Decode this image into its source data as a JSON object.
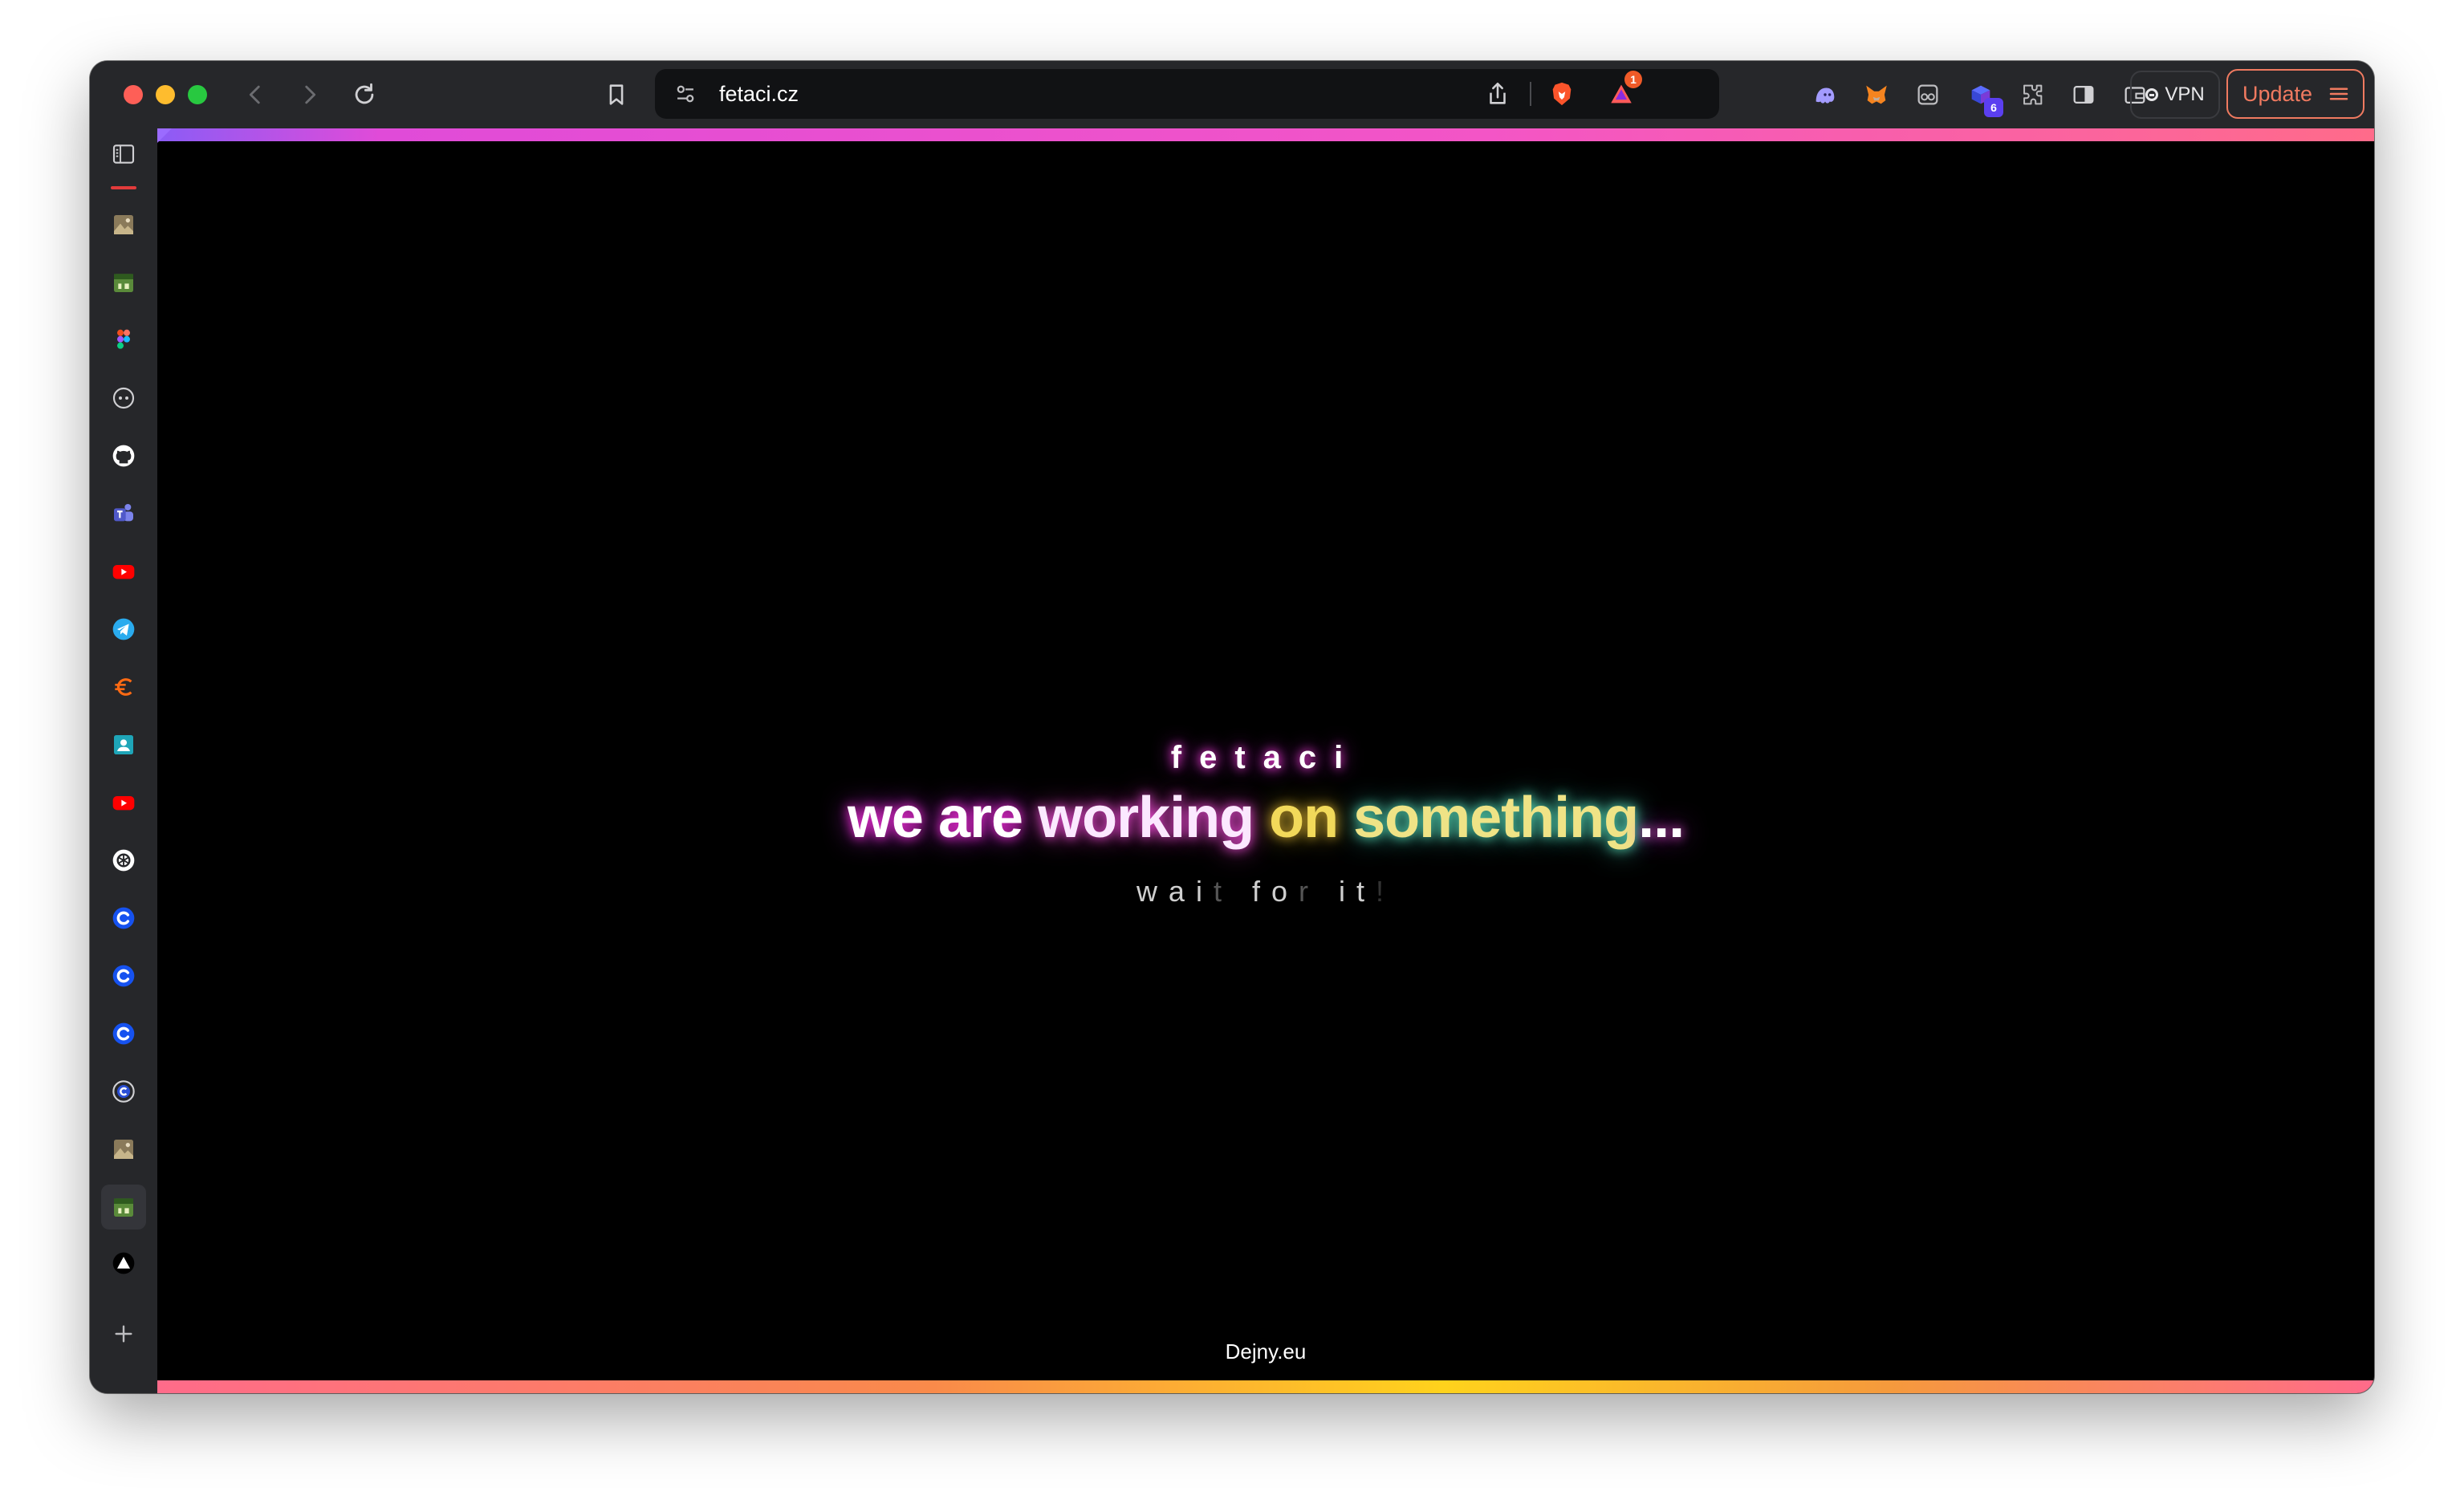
{
  "browser": {
    "url": "fetaci.cz",
    "vpn_label": "VPN",
    "update_label": "Update",
    "alert_badge": "1",
    "extension_badge": "6"
  },
  "sidebar": {
    "items": [
      "sidebar-toggle-icon",
      "image-icon",
      "calendar-icon",
      "figma-icon",
      "chat-icon",
      "github-icon",
      "teams-icon",
      "youtube-icon",
      "telegram-icon",
      "euro-icon",
      "contacts-icon",
      "youtube-icon",
      "openai-icon",
      "c-icon",
      "c-icon",
      "c-icon",
      "c-ring-icon",
      "image-icon",
      "calendar-icon",
      "triangle-icon",
      "plus-icon"
    ]
  },
  "page": {
    "brand": "fetaci",
    "headline_parts": [
      "we are ",
      "working ",
      "on ",
      "something",
      "..."
    ],
    "tagline_parts": [
      "wai",
      "t",
      " fo",
      "r",
      " it",
      "!"
    ],
    "footer": "Dejny.eu"
  },
  "colors": {
    "accent_magenta": "#f355c6",
    "accent_yellow": "#ffd21c",
    "update_orange": "#f07a60"
  }
}
